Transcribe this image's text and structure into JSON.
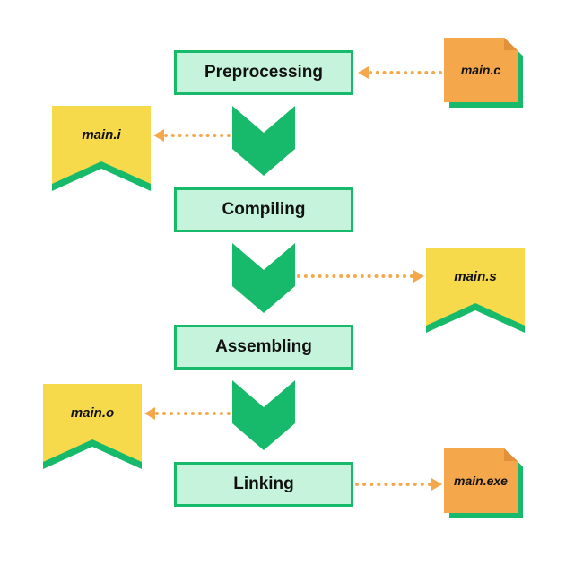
{
  "stages": {
    "preprocessing": "Preprocessing",
    "compiling": "Compiling",
    "assembling": "Assembling",
    "linking": "Linking"
  },
  "files": {
    "input": "main.c",
    "preprocessed": "main.i",
    "assembly": "main.s",
    "object": "main.o",
    "executable": "main.exe"
  },
  "colors": {
    "stage_fill": "#c5f3dc",
    "stage_border": "#17b96a",
    "arrow_green": "#17b96a",
    "file_orange": "#f5a84b",
    "ribbon_yellow": "#f7d94c",
    "dotted": "#f5a84b"
  }
}
